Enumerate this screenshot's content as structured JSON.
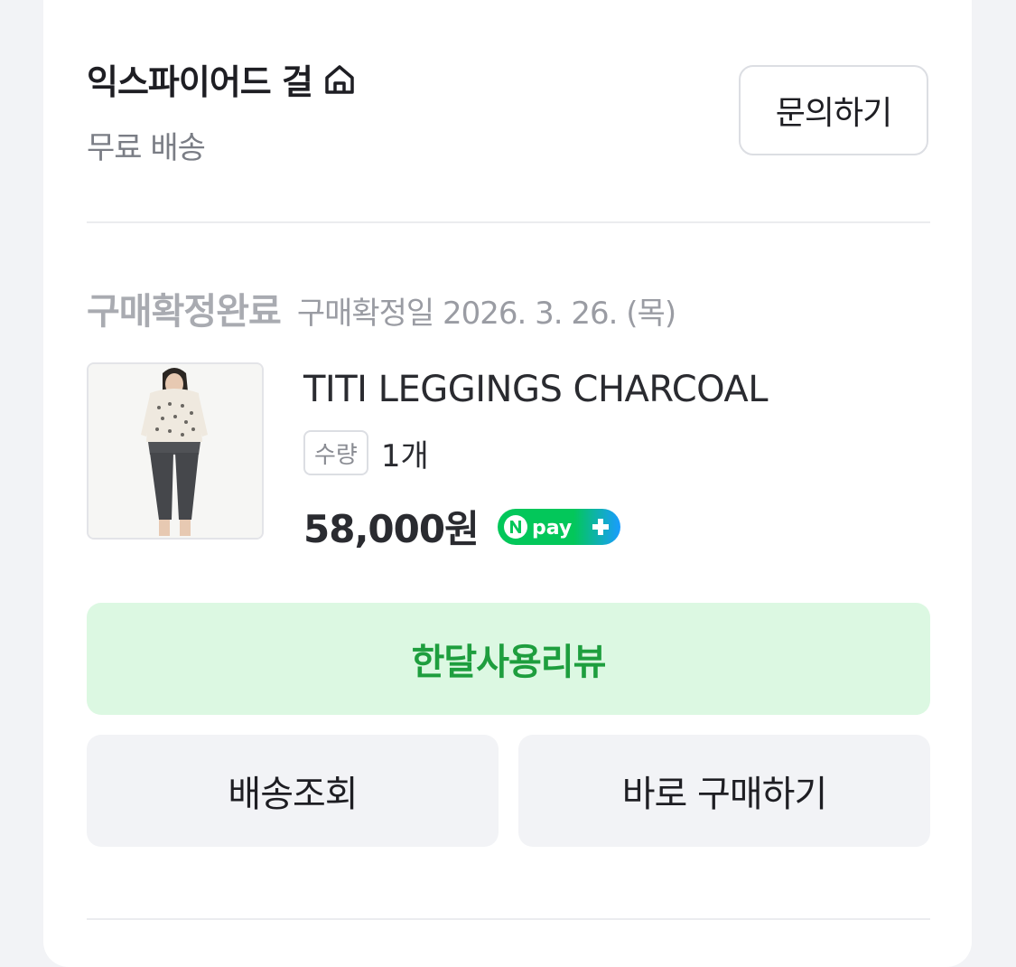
{
  "seller": {
    "name": "익스파이어드 걸",
    "home_icon": "home-icon",
    "shipping": "무료 배송",
    "inquiry_label": "문의하기"
  },
  "order": {
    "status": "구매확정완료",
    "status_date": "구매확정일 2026. 3. 26. (목)",
    "product": {
      "name": "TITI LEGGINGS CHARCOAL",
      "qty_label": "수량",
      "qty_value": "1개",
      "price": "58,000원",
      "pay_badge": "npay-plus-icon"
    }
  },
  "actions": {
    "review_label": "한달사용리뷰",
    "tracking_label": "배송조회",
    "buy_again_label": "바로 구매하기"
  },
  "colors": {
    "review_bg": "#dcf8e2",
    "review_text": "#1e9e3e",
    "npay_green": "#03c75a",
    "npay_blue": "#1a9cff"
  }
}
